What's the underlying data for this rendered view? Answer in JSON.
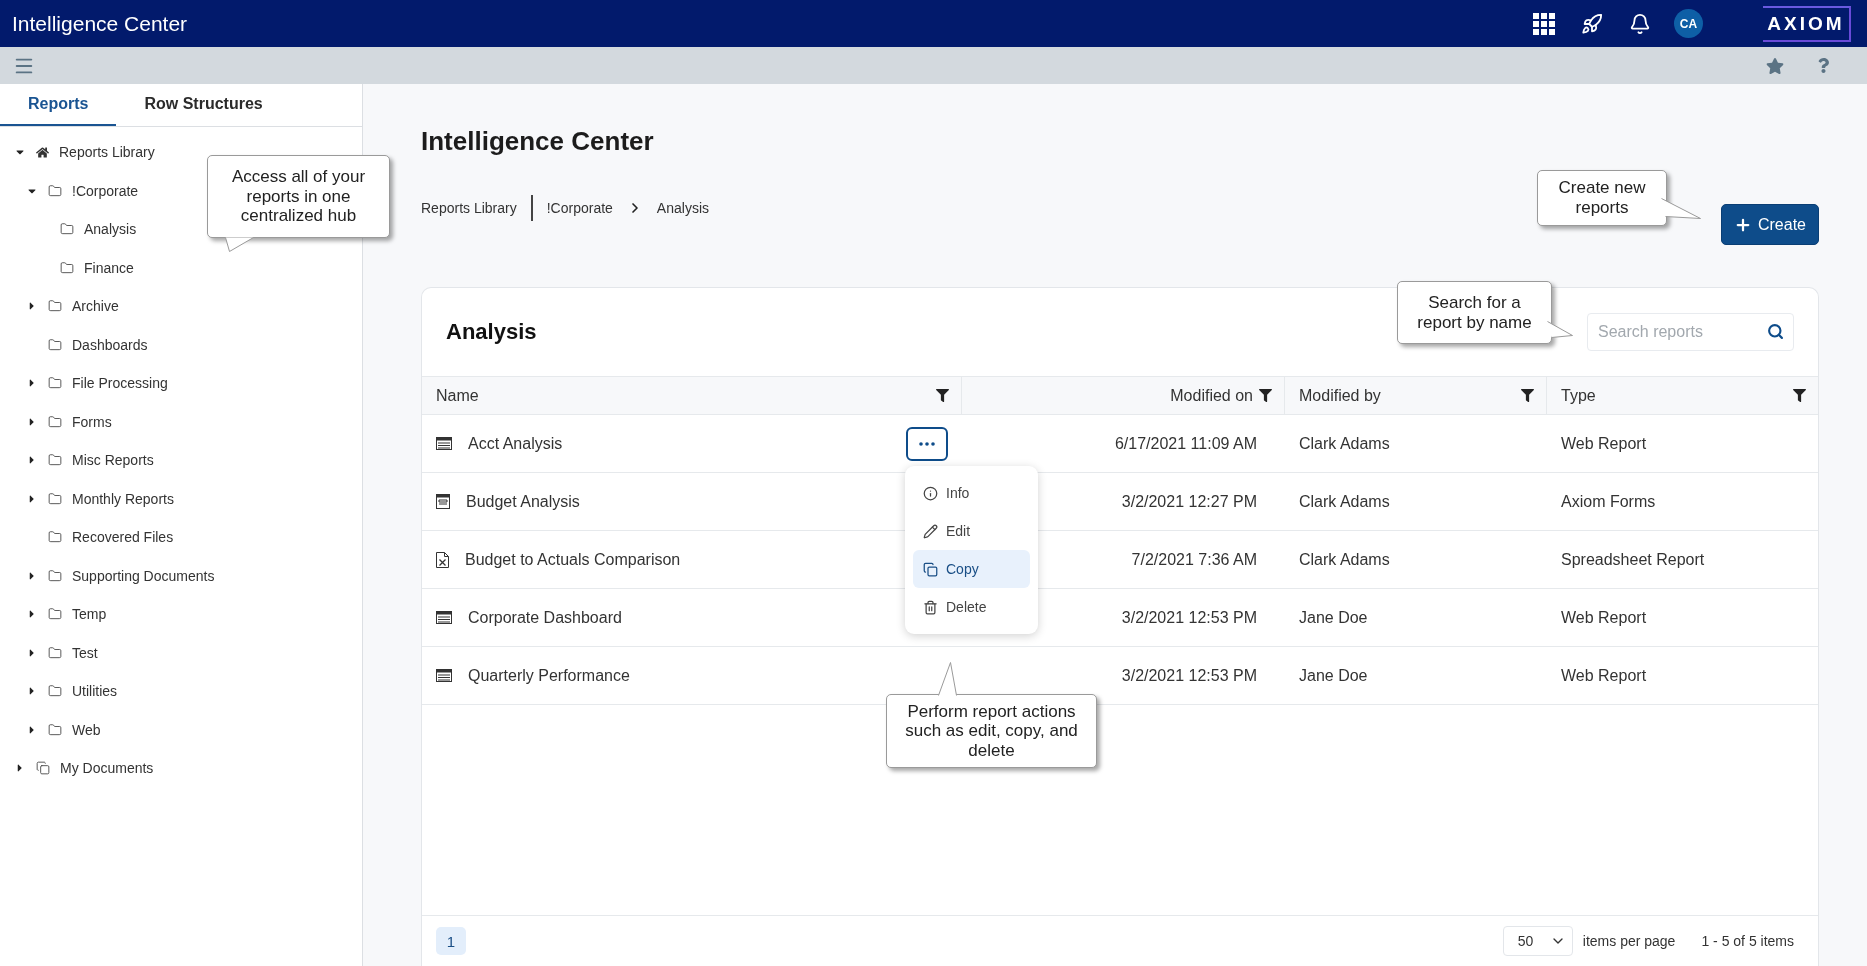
{
  "app_bar": {
    "title": "Intelligence Center",
    "avatar": "CA",
    "logo": "AXIOM"
  },
  "sidebar": {
    "tabs": [
      {
        "label": "Reports",
        "selected": true
      },
      {
        "label": "Row Structures",
        "selected": false
      }
    ],
    "tree": [
      {
        "label": "Reports Library",
        "kind": "home",
        "expanded": true,
        "children": [
          {
            "label": "!Corporate",
            "kind": "folder",
            "expanded": true,
            "children": [
              {
                "label": "Analysis",
                "kind": "folder"
              },
              {
                "label": "Finance",
                "kind": "folder"
              }
            ]
          },
          {
            "label": "Archive",
            "kind": "folder",
            "expanded": false
          },
          {
            "label": "Dashboards",
            "kind": "folder"
          },
          {
            "label": "File Processing",
            "kind": "folder",
            "expanded": false
          },
          {
            "label": "Forms",
            "kind": "folder",
            "expanded": false
          },
          {
            "label": "Misc Reports",
            "kind": "folder",
            "expanded": false
          },
          {
            "label": "Monthly Reports",
            "kind": "folder",
            "expanded": false
          },
          {
            "label": "Recovered Files",
            "kind": "folder"
          },
          {
            "label": "Supporting Documents",
            "kind": "folder",
            "expanded": false
          },
          {
            "label": "Temp",
            "kind": "folder",
            "expanded": false
          },
          {
            "label": "Test",
            "kind": "folder",
            "expanded": false
          },
          {
            "label": "Utilities",
            "kind": "folder",
            "expanded": false
          },
          {
            "label": "Web",
            "kind": "folder",
            "expanded": false
          }
        ]
      },
      {
        "label": "My Documents",
        "kind": "documents",
        "expanded": false
      }
    ]
  },
  "main": {
    "title": "Intelligence Center",
    "breadcrumb": [
      "Reports Library",
      "!Corporate",
      "Analysis"
    ],
    "create_button": "Create",
    "card": {
      "title": "Analysis",
      "search": {
        "placeholder": "Search reports"
      },
      "columns": [
        {
          "label": "Name"
        },
        {
          "label": "Modified on"
        },
        {
          "label": "Modified by"
        },
        {
          "label": "Type"
        }
      ],
      "rows": [
        {
          "kind": "web",
          "name": "Acct Analysis",
          "modified_on": "6/17/2021 11:09 AM",
          "modified_by": "Clark Adams",
          "type": "Web Report",
          "menu_open": true
        },
        {
          "kind": "form",
          "name": "Budget Analysis",
          "modified_on": "3/2/2021 12:27 PM",
          "modified_by": "Clark Adams",
          "type": "Axiom Forms",
          "menu_open": false
        },
        {
          "kind": "spreadsheet",
          "name": "Budget to Actuals Comparison",
          "modified_on": "7/2/2021 7:36 AM",
          "modified_by": "Clark Adams",
          "type": "Spreadsheet Report",
          "menu_open": false
        },
        {
          "kind": "web",
          "name": "Corporate Dashboard",
          "modified_on": "3/2/2021 12:53 PM",
          "modified_by": "Jane Doe",
          "type": "Web Report",
          "menu_open": false
        },
        {
          "kind": "web",
          "name": "Quarterly Performance",
          "modified_on": "3/2/2021 12:53 PM",
          "modified_by": "Jane Doe",
          "type": "Web Report",
          "menu_open": false
        }
      ],
      "row_menu": [
        {
          "label": "Info",
          "kind": "info",
          "selected": false
        },
        {
          "label": "Edit",
          "kind": "edit",
          "selected": false
        },
        {
          "label": "Copy",
          "kind": "copy",
          "selected": true
        },
        {
          "label": "Delete",
          "kind": "delete",
          "selected": false
        }
      ],
      "footer": {
        "pages": [
          {
            "label": "1",
            "selected": true
          }
        ],
        "page_size": "50",
        "page_size_label": "items per page",
        "summary": "1 - 5 of 5 items"
      }
    }
  },
  "callouts": [
    "Access all of your reports in one centralized hub",
    "Create new reports",
    "Search for a report by name",
    "Perform report actions such as edit, copy, and delete"
  ]
}
